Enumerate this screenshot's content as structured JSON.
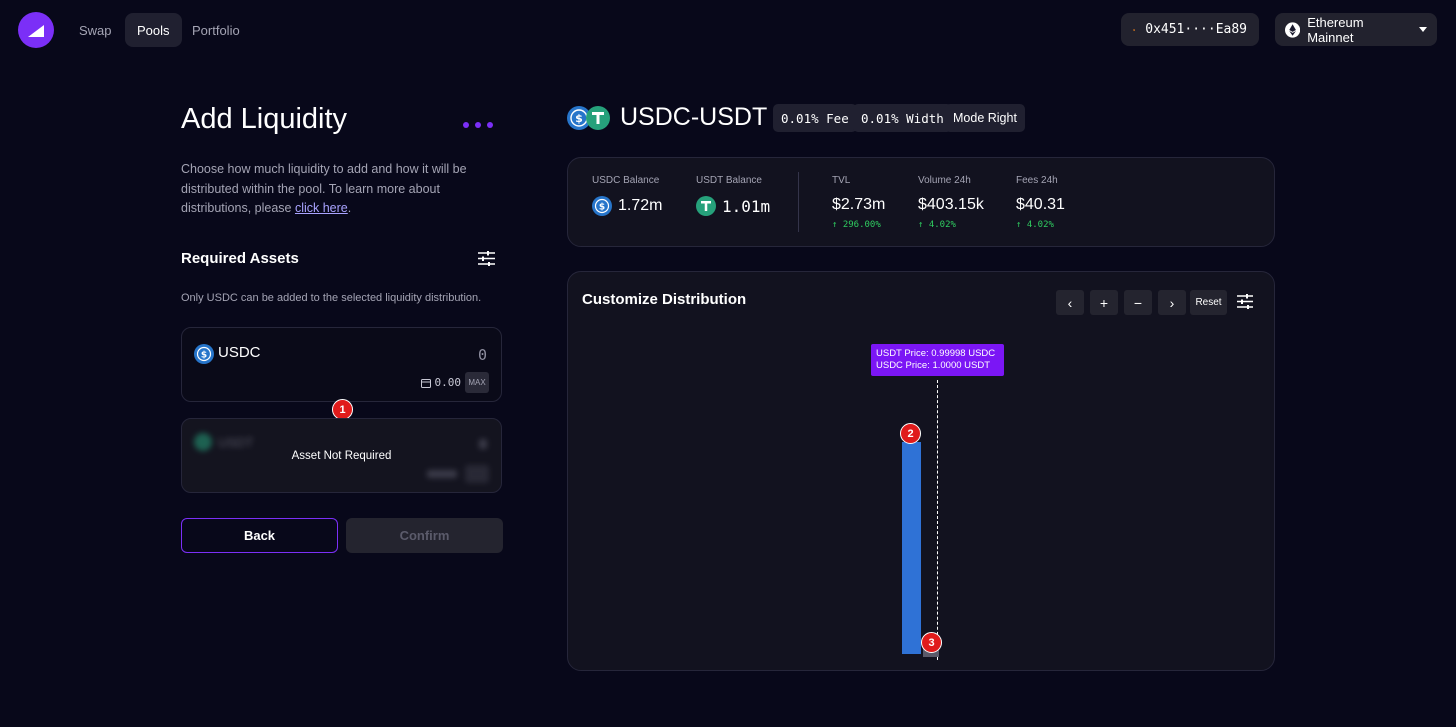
{
  "nav": {
    "links": [
      "Swap",
      "Pools",
      "Portfolio"
    ],
    "active": "Pools",
    "wallet_address": "0x451····Ea89",
    "network": "Ethereum Mainnet"
  },
  "left": {
    "title": "Add Liquidity",
    "description": "Choose how much liquidity to add and how it will be distributed within the pool. To learn more about distributions, please ",
    "description_link": "click here",
    "description_end": ".",
    "required_assets_title": "Required Assets",
    "hint": "Only USDC can be added to the selected liquidity distribution.",
    "usdc_card": {
      "symbol": "USDC",
      "amount": "0",
      "balance": "0.00",
      "max_label": "MAX"
    },
    "usdt_card": {
      "symbol": "USDT",
      "overlay": "Asset Not Required"
    },
    "back_label": "Back",
    "confirm_label": "Confirm"
  },
  "pool": {
    "pair": "USDC-USDT",
    "fee": "0.01% Fee",
    "width": "0.01% Width",
    "mode": "Mode Right"
  },
  "stats": {
    "usdc_balance_label": "USDC Balance",
    "usdc_balance": "1.72m",
    "usdt_balance_label": "USDT Balance",
    "usdt_balance": "1.01m",
    "tvl_label": "TVL",
    "tvl": "$2.73m",
    "tvl_change": "↑ 296.00%",
    "volume_label": "Volume 24h",
    "volume": "$403.15k",
    "volume_change": "↑ 4.02%",
    "fees_label": "Fees 24h",
    "fees": "$40.31",
    "fees_change": "↑ 4.02%"
  },
  "distribution": {
    "title": "Customize Distribution",
    "controls": [
      "‹",
      "+",
      "−",
      "›"
    ],
    "reset_label": "Reset",
    "tooltip_line1": "USDT Price:  0.99998 USDC",
    "tooltip_line2": "USDC Price:  1.0000 USDT"
  },
  "annotations": [
    "1",
    "2",
    "3"
  ],
  "colors": {
    "accent": "#7b2ff7",
    "bar_blue": "#2f72d6",
    "positive": "#2fcb60",
    "usdc": "#2775ca",
    "usdt": "#26a17b",
    "badge": "#e01b1b"
  }
}
